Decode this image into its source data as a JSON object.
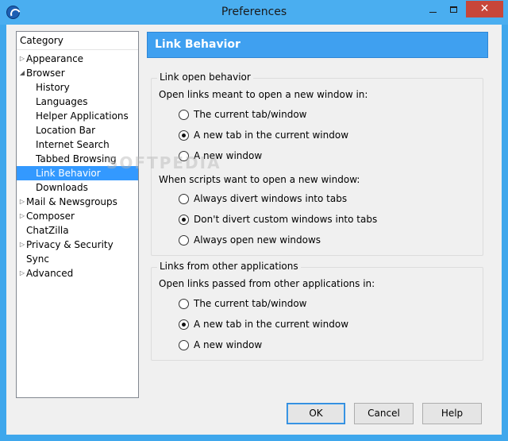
{
  "window": {
    "title": "Preferences",
    "close_glyph": "✕"
  },
  "sidebar": {
    "header": "Category",
    "items": [
      {
        "label": "Appearance",
        "arrow": "▷"
      },
      {
        "label": "Browser",
        "arrow": "◢"
      },
      {
        "label": "History",
        "arrow": ""
      },
      {
        "label": "Languages",
        "arrow": ""
      },
      {
        "label": "Helper Applications",
        "arrow": ""
      },
      {
        "label": "Location Bar",
        "arrow": ""
      },
      {
        "label": "Internet Search",
        "arrow": ""
      },
      {
        "label": "Tabbed Browsing",
        "arrow": ""
      },
      {
        "label": "Link Behavior",
        "arrow": "",
        "selected": true
      },
      {
        "label": "Downloads",
        "arrow": ""
      },
      {
        "label": "Mail & Newsgroups",
        "arrow": "▷"
      },
      {
        "label": "Composer",
        "arrow": "▷"
      },
      {
        "label": "ChatZilla",
        "arrow": ""
      },
      {
        "label": "Privacy & Security",
        "arrow": "▷"
      },
      {
        "label": "Sync",
        "arrow": ""
      },
      {
        "label": "Advanced",
        "arrow": "▷"
      }
    ]
  },
  "panel": {
    "title": "Link Behavior"
  },
  "link_open": {
    "title": "Link open behavior",
    "new_window_prompt": "Open links meant to open a new window in:",
    "new_window_options": [
      {
        "label": "The current tab/window",
        "checked": false
      },
      {
        "label": "A new tab in the current window",
        "checked": true
      },
      {
        "label": "A new window",
        "checked": false
      }
    ],
    "scripts_prompt": "When scripts want to open a new window:",
    "scripts_options": [
      {
        "label": "Always divert windows into tabs",
        "checked": false
      },
      {
        "label": "Don't divert custom windows into tabs",
        "checked": true
      },
      {
        "label": "Always open new windows",
        "checked": false
      }
    ]
  },
  "other_apps": {
    "title": "Links from other applications",
    "prompt": "Open links passed from other applications in:",
    "options": [
      {
        "label": "The current tab/window",
        "checked": false
      },
      {
        "label": "A new tab in the current window",
        "checked": true
      },
      {
        "label": "A new window",
        "checked": false
      }
    ]
  },
  "buttons": {
    "ok": "OK",
    "cancel": "Cancel",
    "help": "Help"
  },
  "watermark": "SOFTPEDIA"
}
